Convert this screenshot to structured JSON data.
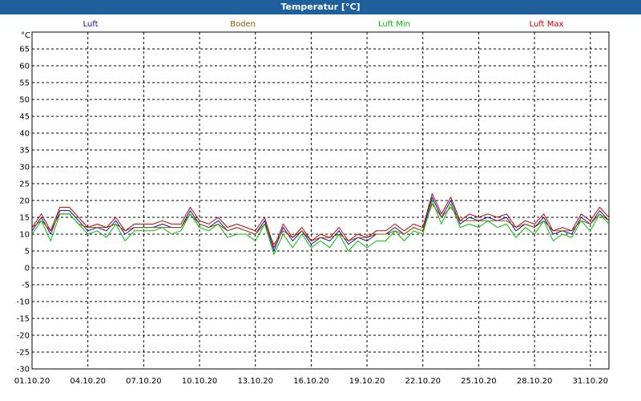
{
  "window": {
    "title": "Temperatur [°C]"
  },
  "chart_data": {
    "type": "line",
    "ylabel": "°C",
    "ylim": [
      -30,
      70
    ],
    "yticks": [
      65,
      60,
      55,
      50,
      45,
      40,
      35,
      30,
      25,
      20,
      15,
      10,
      5,
      0,
      -5,
      -10,
      -15,
      -20,
      -25,
      -30
    ],
    "xlim": [
      "01.10.20",
      "01.11.20"
    ],
    "x_tick_labels": [
      "01.10.20",
      "04.10.20",
      "07.10.20",
      "10.10.20",
      "13.10.20",
      "16.10.20",
      "19.10.20",
      "22.10.20",
      "25.10.20",
      "28.10.20",
      "31.10.20"
    ],
    "grid": true,
    "legend_position": "top",
    "x": [
      "01.10.20",
      "01.10.20 12h",
      "02.10.20",
      "02.10.20 12h",
      "03.10.20",
      "03.10.20 12h",
      "04.10.20",
      "04.10.20 12h",
      "05.10.20",
      "05.10.20 12h",
      "06.10.20",
      "06.10.20 12h",
      "07.10.20",
      "07.10.20 12h",
      "08.10.20",
      "08.10.20 12h",
      "09.10.20",
      "09.10.20 12h",
      "10.10.20",
      "10.10.20 12h",
      "11.10.20",
      "11.10.20 12h",
      "12.10.20",
      "12.10.20 12h",
      "13.10.20",
      "13.10.20 12h",
      "14.10.20",
      "14.10.20 12h",
      "15.10.20",
      "15.10.20 12h",
      "16.10.20",
      "16.10.20 12h",
      "17.10.20",
      "17.10.20 12h",
      "18.10.20",
      "18.10.20 12h",
      "19.10.20",
      "19.10.20 12h",
      "20.10.20",
      "20.10.20 12h",
      "21.10.20",
      "21.10.20 12h",
      "22.10.20",
      "22.10.20 12h",
      "23.10.20",
      "23.10.20 12h",
      "24.10.20",
      "24.10.20 12h",
      "25.10.20",
      "25.10.20 12h",
      "26.10.20",
      "26.10.20 12h",
      "27.10.20",
      "27.10.20 12h",
      "28.10.20",
      "28.10.20 12h",
      "29.10.20",
      "29.10.20 12h",
      "30.10.20",
      "30.10.20 12h",
      "31.10.20",
      "31.10.20 12h",
      "01.11.20"
    ],
    "series": [
      {
        "name": "Luft",
        "color": "#1010b0",
        "values": [
          11,
          15,
          10,
          17,
          17,
          14,
          11,
          12,
          11,
          14,
          10,
          12,
          12,
          12,
          13,
          12,
          12,
          17,
          13,
          12,
          14,
          11,
          12,
          11,
          10,
          14,
          5,
          12,
          8,
          11,
          7,
          9,
          8,
          11,
          7,
          9,
          8,
          10,
          10,
          12,
          10,
          12,
          11,
          21,
          15,
          20,
          13,
          15,
          14,
          15,
          14,
          15,
          11,
          13,
          12,
          15,
          10,
          11,
          10,
          15,
          13,
          17,
          14
        ]
      },
      {
        "name": "Boden",
        "color": "#8b5a00",
        "values": [
          12,
          14,
          11,
          16,
          16,
          13,
          12,
          12,
          12,
          13,
          11,
          12,
          12,
          12,
          12,
          12,
          12,
          16,
          13,
          12,
          13,
          11,
          12,
          11,
          10,
          13,
          7,
          11,
          9,
          11,
          8,
          9,
          9,
          10,
          8,
          9,
          9,
          10,
          10,
          11,
          10,
          12,
          11,
          19,
          15,
          18,
          14,
          14,
          14,
          14,
          14,
          14,
          12,
          13,
          12,
          14,
          11,
          11,
          11,
          14,
          13,
          16,
          14
        ]
      },
      {
        "name": "Luft Min",
        "color": "#00c000",
        "values": [
          10,
          14,
          8,
          16,
          16,
          13,
          10,
          11,
          9,
          13,
          8,
          11,
          11,
          11,
          12,
          10,
          11,
          16,
          12,
          11,
          13,
          9,
          10,
          10,
          8,
          13,
          4,
          10,
          6,
          10,
          6,
          8,
          6,
          10,
          5,
          8,
          6,
          8,
          8,
          11,
          8,
          11,
          10,
          20,
          13,
          19,
          12,
          13,
          12,
          14,
          12,
          13,
          9,
          12,
          10,
          14,
          8,
          10,
          9,
          14,
          11,
          16,
          13
        ]
      },
      {
        "name": "Luft Max",
        "color": "#c00000",
        "values": [
          12,
          16,
          11,
          18,
          18,
          15,
          12,
          13,
          12,
          15,
          11,
          13,
          13,
          13,
          14,
          13,
          13,
          18,
          14,
          13,
          15,
          12,
          13,
          12,
          11,
          15,
          6,
          13,
          9,
          12,
          8,
          10,
          9,
          12,
          8,
          10,
          9,
          11,
          11,
          13,
          11,
          13,
          12,
          22,
          16,
          21,
          14,
          16,
          15,
          16,
          15,
          16,
          12,
          14,
          13,
          16,
          11,
          12,
          11,
          16,
          14,
          18,
          15
        ]
      }
    ]
  }
}
